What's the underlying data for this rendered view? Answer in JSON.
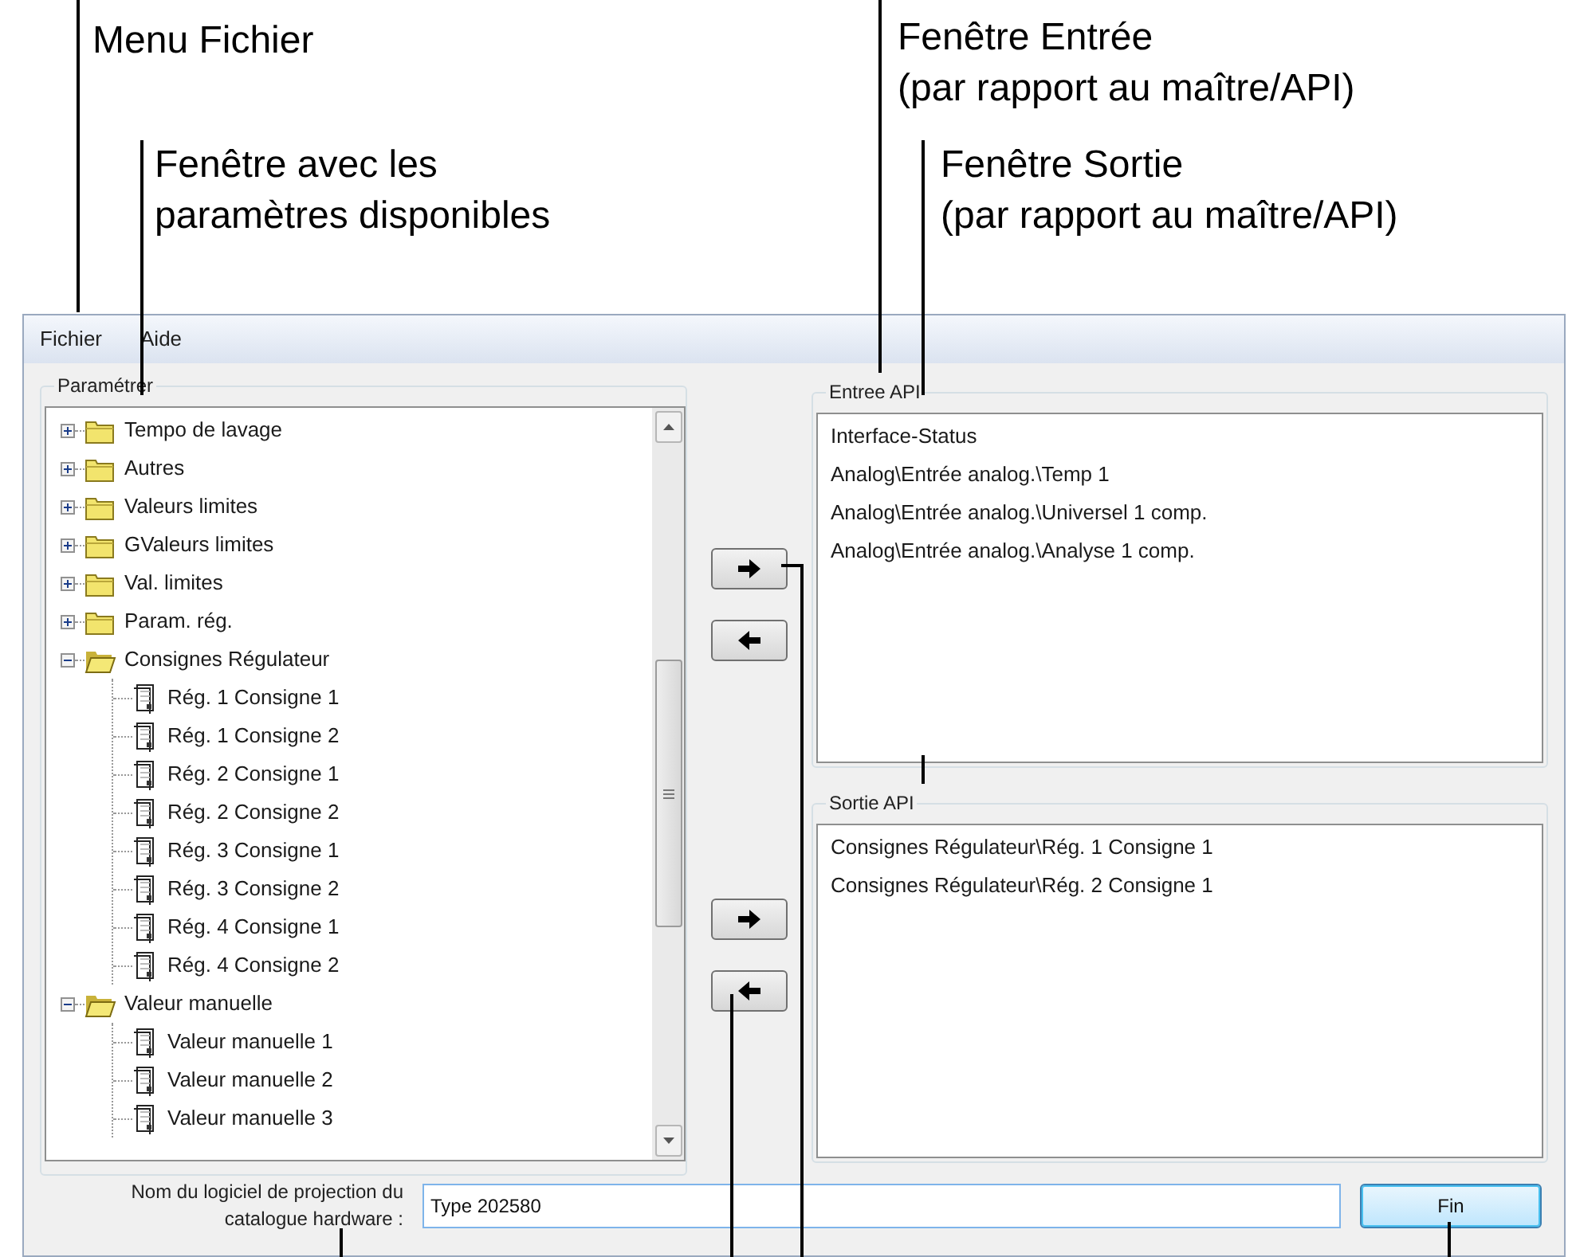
{
  "annotations": [
    {
      "text": "Menu Fichier"
    },
    {
      "text": "Fenêtre avec les\nparamètres disponibles"
    },
    {
      "text": "Fenêtre Entrée\n(par rapport au maître/API)"
    },
    {
      "text": "Fenêtre Sortie\n(par rapport au maître/API)"
    }
  ],
  "menu": [
    "Fichier",
    "Aide"
  ],
  "parameters": {
    "title": "Paramétrer",
    "tree": [
      {
        "label": "Tempo de lavage",
        "expanded": false
      },
      {
        "label": "Autres",
        "expanded": false
      },
      {
        "label": "Valeurs limites",
        "expanded": false
      },
      {
        "label": "GValeurs limites",
        "expanded": false
      },
      {
        "label": "Val. limites",
        "expanded": false
      },
      {
        "label": "Param. rég.",
        "expanded": false
      },
      {
        "label": "Consignes Régulateur",
        "expanded": true,
        "children": [
          {
            "label": "Rég. 1 Consigne 1"
          },
          {
            "label": "Rég. 1 Consigne 2"
          },
          {
            "label": "Rég. 2 Consigne 1"
          },
          {
            "label": "Rég. 2 Consigne 2"
          },
          {
            "label": "Rég. 3 Consigne 1"
          },
          {
            "label": "Rég. 3 Consigne 2"
          },
          {
            "label": "Rég. 4 Consigne 1"
          },
          {
            "label": "Rég. 4 Consigne 2"
          }
        ]
      },
      {
        "label": "Valeur manuelle",
        "expanded": true,
        "children": [
          {
            "label": "Valeur manuelle 1"
          },
          {
            "label": "Valeur manuelle 2"
          },
          {
            "label": "Valeur manuelle 3"
          }
        ]
      }
    ]
  },
  "input_panel": {
    "title": "Entree API",
    "items": [
      "Interface-Status",
      "Analog\\Entrée analog.\\Temp 1",
      "Analog\\Entrée analog.\\Universel 1 comp.",
      "Analog\\Entrée analog.\\Analyse 1 comp."
    ]
  },
  "output_panel": {
    "title": "Sortie API",
    "items": [
      "Consignes Régulateur\\Rég. 1 Consigne 1",
      "Consignes Régulateur\\Rég. 2 Consigne 1"
    ]
  },
  "project_name": {
    "label": "Nom du logiciel de projection du\ncatalogue hardware :",
    "value": "Type 202580"
  },
  "finish_button": "Fin"
}
